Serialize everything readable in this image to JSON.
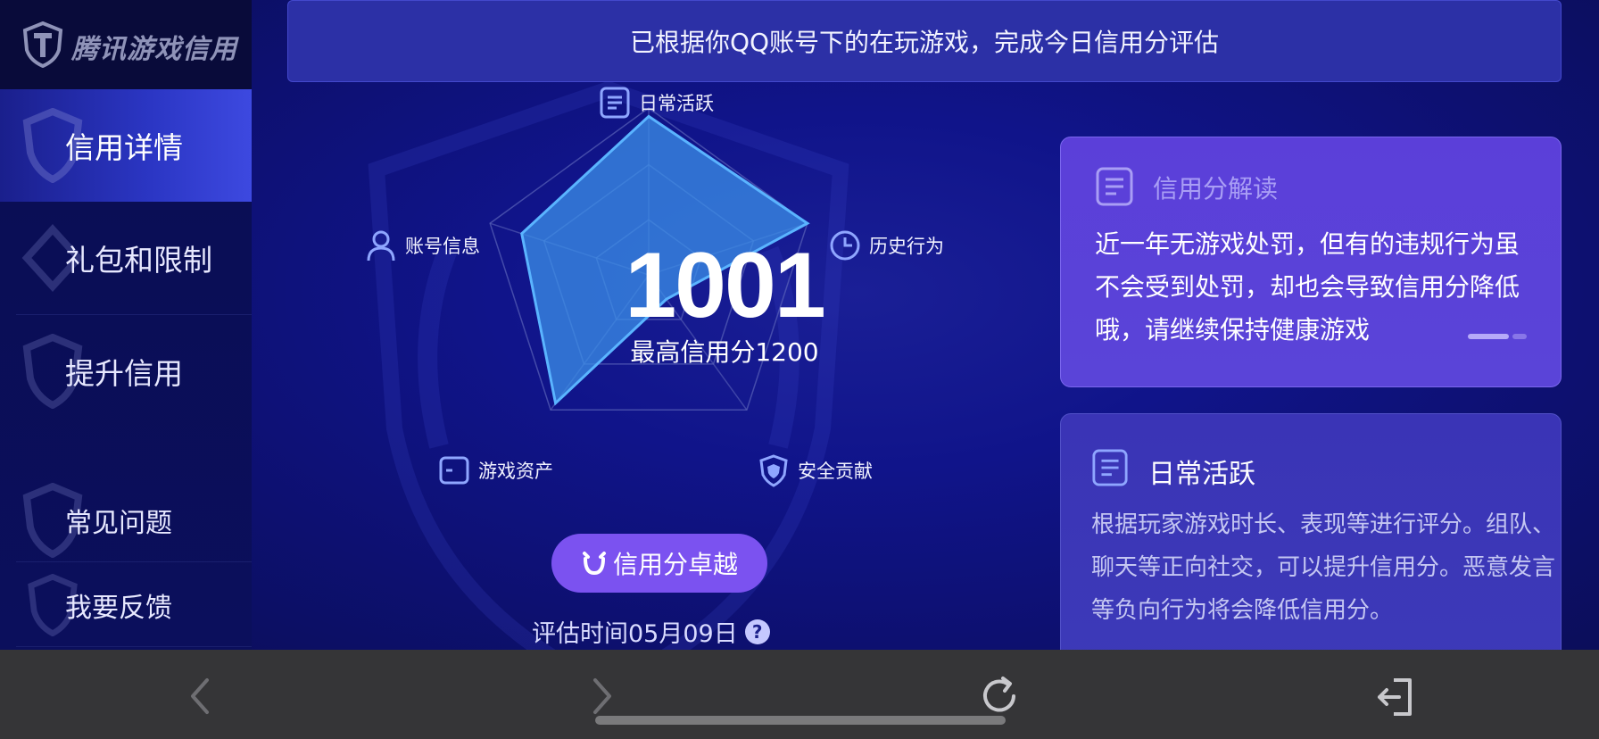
{
  "brand": {
    "name": "腾讯游戏信用"
  },
  "sidebar": {
    "items": [
      {
        "label": "信用详情",
        "active": true
      },
      {
        "label": "礼包和限制",
        "active": false
      },
      {
        "label": "提升信用",
        "active": false
      },
      {
        "label": "常见问题",
        "active": false
      },
      {
        "label": "我要反馈",
        "active": false
      }
    ]
  },
  "banner": {
    "text": "已根据你QQ账号下的在玩游戏，完成今日信用分评估"
  },
  "radar": {
    "axes": [
      {
        "label": "日常活跃",
        "icon": "document-icon",
        "value": 0.95
      },
      {
        "label": "历史行为",
        "icon": "clock-icon",
        "value": 1.0
      },
      {
        "label": "安全贡献",
        "icon": "shield-icon",
        "value": 0.18
      },
      {
        "label": "游戏资产",
        "icon": "wallet-icon",
        "value": 0.95
      },
      {
        "label": "账号信息",
        "icon": "user-icon",
        "value": 0.8
      }
    ]
  },
  "score": {
    "value": "1001",
    "max_label": "最高信用分1200"
  },
  "level_button": {
    "label": "信用分卓越"
  },
  "eval_time": {
    "label": "评估时间05月09日",
    "help": "?"
  },
  "card_interpret": {
    "title": "信用分解读",
    "text": "近一年无游戏处罚，但有的违规行为虽不会受到处罚，却也会导致信用分降低哦，请继续保持健康游戏"
  },
  "card_daily": {
    "title": "日常活跃",
    "text": "根据玩家游戏时长、表现等进行评分。组队、聊天等正向社交，可以提升信用分。恶意发言等负向行为将会降低信用分。"
  },
  "colors": {
    "accent": "#7b52f0",
    "radar_fill": "#3b8fe8",
    "radar_stroke": "#5ab4ff",
    "background": "#10148a"
  }
}
